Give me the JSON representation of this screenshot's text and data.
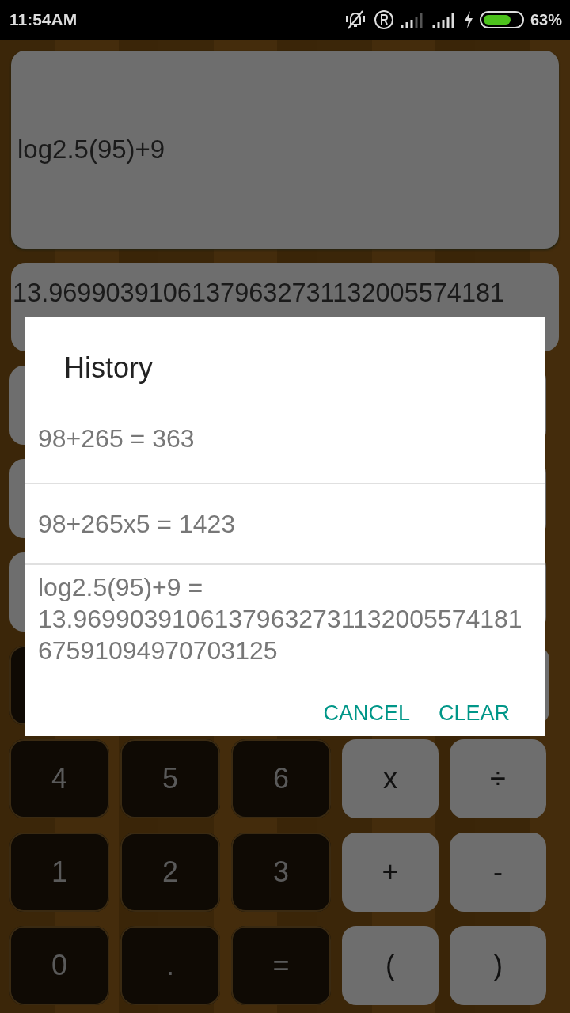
{
  "status_bar": {
    "time": "11:54AM",
    "battery": "63%"
  },
  "display": {
    "expression": "log2.5(95)+9",
    "result": "13.96990391061379632731132005574181"
  },
  "keypad": [
    [
      {
        "label": "4",
        "kind": "digit"
      },
      {
        "label": "5",
        "kind": "digit"
      },
      {
        "label": "6",
        "kind": "digit"
      },
      {
        "label": "x",
        "kind": "operator"
      },
      {
        "label": "÷",
        "kind": "operator"
      }
    ],
    [
      {
        "label": "1",
        "kind": "digit"
      },
      {
        "label": "2",
        "kind": "digit"
      },
      {
        "label": "3",
        "kind": "digit"
      },
      {
        "label": "+",
        "kind": "operator"
      },
      {
        "label": "-",
        "kind": "operator"
      }
    ],
    [
      {
        "label": "0",
        "kind": "digit"
      },
      {
        "label": ".",
        "kind": "digit"
      },
      {
        "label": "=",
        "kind": "digit"
      },
      {
        "label": "(",
        "kind": "operator"
      },
      {
        "label": ")",
        "kind": "operator"
      }
    ]
  ],
  "dialog": {
    "title": "History",
    "items": [
      "98+265 = 363",
      "98+265x5 = 1423",
      "log2.5(95)+9 = 13.9699039106137963273113200557418167591094970703125"
    ],
    "buttons": [
      "CANCEL",
      "CLEAR"
    ]
  }
}
